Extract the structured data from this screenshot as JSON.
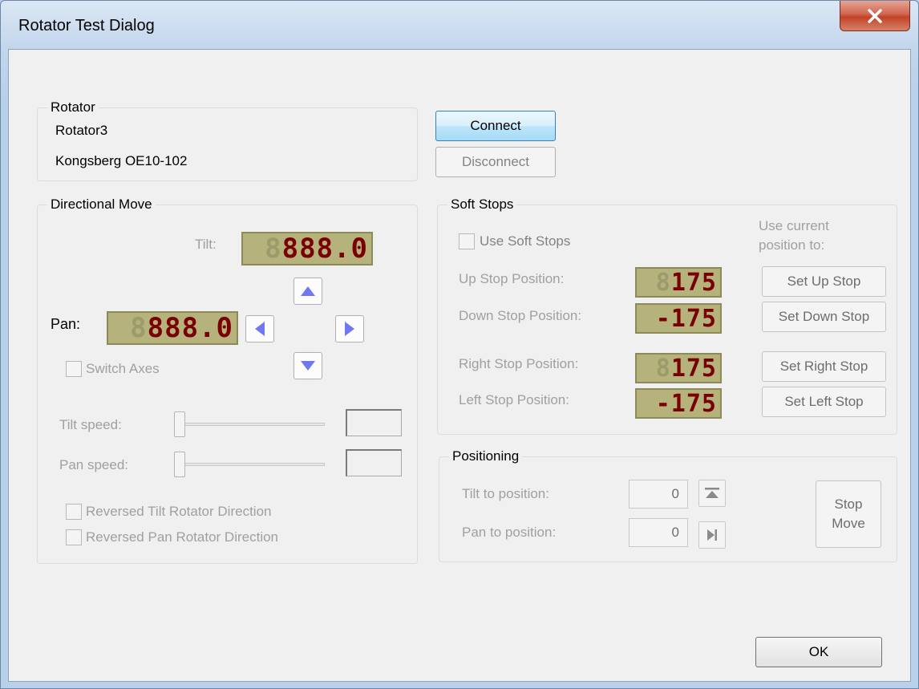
{
  "window": {
    "title": "Rotator Test Dialog",
    "close_symbol": "X"
  },
  "rotator": {
    "label": "Rotator",
    "name": "Rotator3",
    "model": "Kongsberg OE10-102"
  },
  "connection": {
    "connect_label": "Connect",
    "disconnect_label": "Disconnect"
  },
  "directional": {
    "label": "Directional Move",
    "tilt_label": "Tilt:",
    "tilt_display": "888.0",
    "pan_label": "Pan:",
    "pan_display": "888.0",
    "switch_axes_label": "Switch Axes",
    "tilt_speed_label": "Tilt speed:",
    "pan_speed_label": "Pan speed:",
    "reversed_tilt_label": "Reversed Tilt Rotator Direction",
    "reversed_pan_label": "Reversed Pan Rotator Direction"
  },
  "soft_stops": {
    "label": "Soft Stops",
    "use_label": "Use Soft Stops",
    "hint_line1": "Use current",
    "hint_line2": "position to:",
    "up_label": "Up Stop Position:",
    "up_value": "175",
    "down_label": "Down Stop Position:",
    "down_value": "-175",
    "right_label": "Right Stop Position:",
    "right_value": "175",
    "left_label": "Left Stop Position:",
    "left_value": "-175",
    "set_up_label": "Set Up Stop",
    "set_down_label": "Set Down Stop",
    "set_right_label": "Set Right Stop",
    "set_left_label": "Set Left Stop"
  },
  "positioning": {
    "label": "Positioning",
    "tilt_label": "Tilt to position:",
    "tilt_value": "0",
    "pan_label": "Pan to position:",
    "pan_value": "0",
    "stop_line1": "Stop",
    "stop_line2": "Move"
  },
  "footer": {
    "ok_label": "OK"
  },
  "colors": {
    "lcd_bg": "#b5b37b",
    "lcd_digit": "#7a0000",
    "arrow_blue": "#6f78f0"
  }
}
